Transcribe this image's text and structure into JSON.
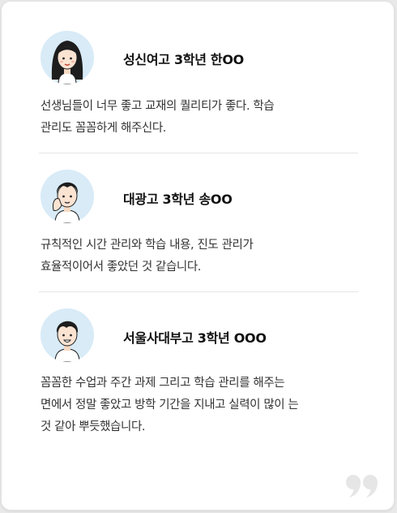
{
  "reviews": [
    {
      "author": "성신여고 3학년 한OO",
      "avatar_icon": "girl-long-hair-avatar-icon",
      "lines": [
        "선생님들이 너무 좋고 교재의 퀄리티가 좋다. 학습",
        "관리도 꼼꼼하게 해주신다."
      ]
    },
    {
      "author": "대광고 3학년 송OO",
      "avatar_icon": "boy-hand-on-cheek-avatar-icon",
      "lines": [
        "규칙적인 시간 관리와 학습 내용, 진도 관리가",
        "효율적이어서 좋았던 것 같습니다."
      ]
    },
    {
      "author": "서울사대부고 3학년 OOO",
      "avatar_icon": "boy-smiling-avatar-icon",
      "lines": [
        "꼼꼼한 수업과 주간 과제 그리고 학습 관리를 해주는",
        "면에서 정말 좋았고 방학 기간을 지내고 실력이 많이 는",
        "것 같아 뿌듯했습니다."
      ]
    }
  ],
  "colors": {
    "avatar_bg": "#d8ebf7",
    "divider": "#e6e6e6",
    "quote_mark": "#e6e6e6"
  },
  "decor_icon": "quote-mark-icon"
}
